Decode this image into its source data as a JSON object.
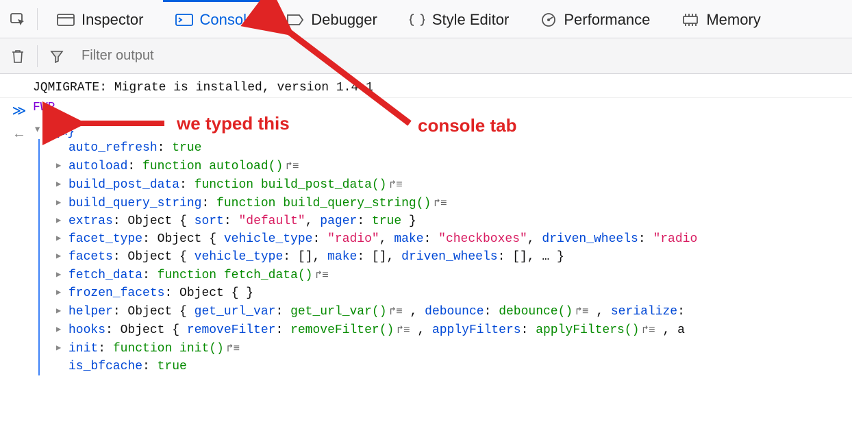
{
  "tabs": {
    "inspector": "Inspector",
    "console": "Console",
    "debugger": "Debugger",
    "style_editor": "Style Editor",
    "performance": "Performance",
    "memory": "Memory"
  },
  "filter": {
    "placeholder": "Filter output"
  },
  "console": {
    "log1": "JQMIGRATE: Migrate is installed, version 1.4.1",
    "input": "FWP",
    "obj_head": "{…}",
    "props": {
      "auto_refresh": {
        "k": "auto_refresh",
        "v": "true",
        "cls": "val-bool",
        "tri": false
      },
      "autoload": {
        "k": "autoload",
        "v": "function autoload()",
        "cls": "kw-func",
        "tri": true,
        "fn": true
      },
      "build_post_data": {
        "k": "build_post_data",
        "v": "function build_post_data()",
        "cls": "kw-func",
        "tri": true,
        "fn": true
      },
      "build_query_string": {
        "k": "build_query_string",
        "v": "function build_query_string()",
        "cls": "kw-func",
        "tri": true,
        "fn": true
      },
      "extras_k": "extras",
      "extras_obj": "Object { ",
      "extras_sort_k": "sort",
      "extras_sort_v": "\"default\"",
      "extras_pager_k": "pager",
      "extras_pager_v": "true",
      "facet_type_k": "facet_type",
      "facet_type_obj": "Object { ",
      "ft_vt_k": "vehicle_type",
      "ft_vt_v": "\"radio\"",
      "ft_make_k": "make",
      "ft_make_v": "\"checkboxes\"",
      "ft_dw_k": "driven_wheels",
      "ft_dw_v": "\"radio",
      "facets_k": "facets",
      "facets_obj": "Object { ",
      "f_vt_k": "vehicle_type",
      "f_empty": "[]",
      "f_make_k": "make",
      "f_dw_k": "driven_wheels",
      "f_more": ", … }",
      "fetch_data_k": "fetch_data",
      "fetch_data_v": "function fetch_data()",
      "frozen_k": "frozen_facets",
      "frozen_v": "Object {  }",
      "helper_k": "helper",
      "helper_obj": "Object { ",
      "h_guv_k": "get_url_var",
      "h_guv_v": "get_url_var()",
      "h_deb_k": "debounce",
      "h_deb_v": "debounce()",
      "h_ser_k": "serialize",
      "hooks_k": "hooks",
      "hooks_obj": "Object { ",
      "hk_rm_k": "removeFilter",
      "hk_rm_v": "removeFilter()",
      "hk_ap_k": "applyFilters",
      "hk_ap_v": "applyFilters()",
      "hk_more": ", a",
      "init_k": "init",
      "init_v": "function init()",
      "is_bfcache_k": "is_bfcache",
      "is_bfcache_v": "true"
    }
  },
  "annotations": {
    "typed": "we typed this",
    "consoletab": "console tab"
  }
}
